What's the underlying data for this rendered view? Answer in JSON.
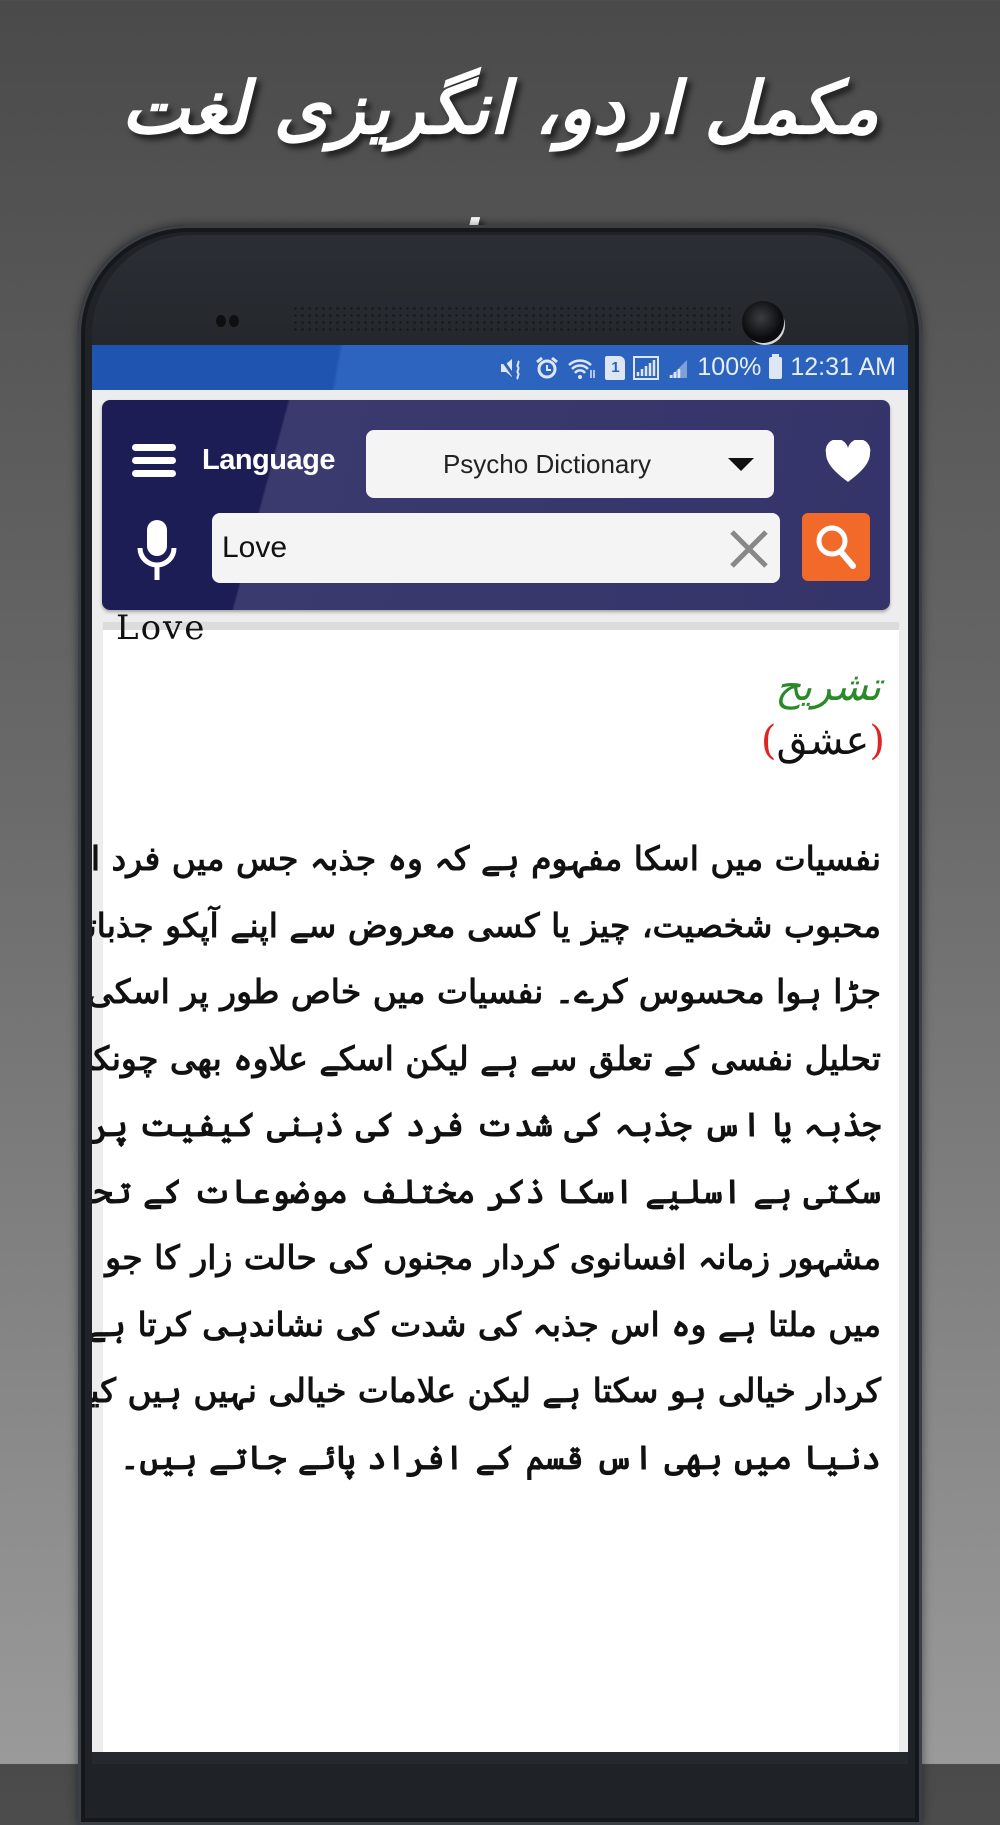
{
  "promo": {
    "title": "مکمل اردو، انگریزی لغت نفسیات"
  },
  "status_bar": {
    "icons": [
      "mute-vibrate-icon",
      "alarm-icon",
      "wifi-icon",
      "sim-1-icon",
      "signal-icon",
      "signal-icon-2",
      "battery-icon"
    ],
    "sim_label": "1",
    "battery_percent": "100%",
    "time": "12:31 AM",
    "color": "#2a62bd"
  },
  "header": {
    "language_label": "Language",
    "dictionary_selected": "Psycho Dictionary",
    "search_value": "Love",
    "search_placeholder": "",
    "accent_color": "#f26a2a",
    "panel_color": "#34346a"
  },
  "entry": {
    "headword": "Love",
    "label": "تشریح",
    "urdu_word": "عشق",
    "paren_open": "(",
    "paren_close": ")",
    "body_lines": [
      "نفسیات میں اسکا مفہوم ہے کہ وہ جذبہ جس میں فرد اپنی کسی",
      "محبوب شخصیت، چیز یا کسی معروض سے اپنے آپکو جذباتی طور پر",
      "جڑا ہوا محسوس کرے۔ نفسیات میں خاص طور پر اسکی اہمیت",
      "تحلیل نفسی کے تعلق سے ہے لیکن اسکے علاوہ بھی چونکہ یہ",
      "جذبہ یا اس جذبہ کی شدت فرد کی ذہنی کیفیت پر اثرانداز ہو",
      "سکتی ہے اسلیے اسکا ذکر مختلف موضوعات کے تحت بھی آتا ہے۔",
      "مشہور زمانہ افسانوی کردار مجنوں کی حالت زار کا جو نقشہ کہانیوں",
      "میں ملتا ہے وہ اس جذبہ کی شدت کی نشاندہی کرتا ہے۔ اسکا",
      "کردار خیالی ہو سکتا ہے لیکن علامات خیالی نہیں ہیں کیونکہ حقیقی",
      "دنیا میں بھی اس قسم کے افراد پائے جاتے ہیں۔"
    ]
  }
}
